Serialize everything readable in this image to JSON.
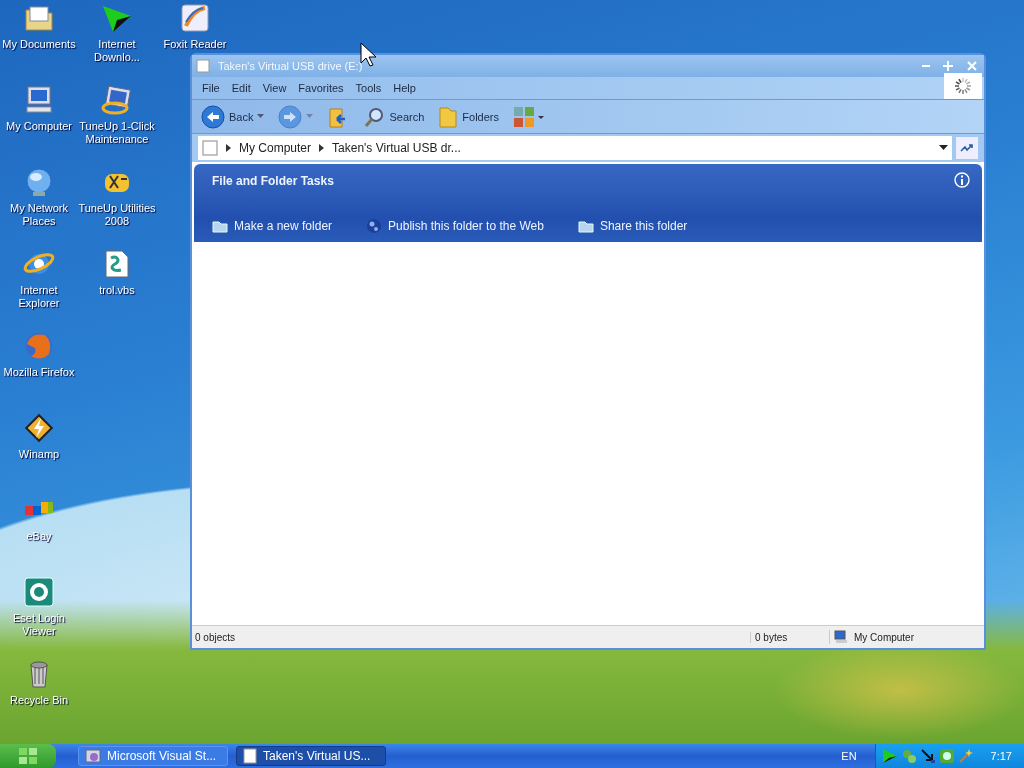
{
  "desktop": {
    "icon_columns": [
      [
        {
          "label": "My Documents",
          "kind": "documents"
        },
        {
          "label": "My Computer",
          "kind": "computer"
        },
        {
          "label": "My Network Places",
          "kind": "network"
        },
        {
          "label": "Internet Explorer",
          "kind": "ie"
        },
        {
          "label": "Mozilla Firefox",
          "kind": "firefox"
        },
        {
          "label": "Winamp",
          "kind": "winamp"
        },
        {
          "label": "eBay",
          "kind": "ebay"
        },
        {
          "label": "Eset Login Viewer",
          "kind": "eset"
        },
        {
          "label": "Recycle Bin",
          "kind": "recycle"
        }
      ],
      [
        {
          "label": "Internet Downlo...",
          "kind": "download"
        },
        {
          "label": "TuneUp 1-Click Maintenance",
          "kind": "tuneup"
        },
        {
          "label": "TuneUp Utilities 2008",
          "kind": "tools"
        },
        {
          "label": "trol.vbs",
          "kind": "script"
        }
      ],
      [
        {
          "label": "Foxit Reader",
          "kind": "pdf"
        }
      ]
    ]
  },
  "window": {
    "title": "Taken's Virtual USB drive (E:)",
    "menu": [
      "File",
      "Edit",
      "View",
      "Favorites",
      "Tools",
      "Help"
    ],
    "toolbar": [
      {
        "kind": "back",
        "label": "Back",
        "disabled": false
      },
      {
        "kind": "forward",
        "disabled": true
      },
      {
        "kind": "up",
        "disabled": false
      },
      {
        "kind": "search",
        "label": "Search",
        "disabled": false
      },
      {
        "kind": "folders",
        "label": "Folders",
        "disabled": false
      },
      {
        "kind": "views",
        "disabled": false
      }
    ],
    "address": {
      "path": [
        "My Computer",
        "Taken's Virtual USB dr..."
      ]
    },
    "task_pane": {
      "title": "File and Folder Tasks",
      "tasks": [
        {
          "label": "Make a new folder",
          "kind": "new-folder"
        },
        {
          "label": "Publish this folder to the Web",
          "kind": "publish"
        },
        {
          "label": "Share this folder",
          "kind": "share"
        }
      ]
    },
    "status_bar": {
      "objects": "0 objects",
      "size": "0 bytes",
      "zone": "My Computer"
    }
  },
  "taskbar": {
    "tasks": [
      {
        "label": "Microsoft Visual St...",
        "selected": false
      },
      {
        "label": "Taken's Virtual US...",
        "selected": true
      }
    ],
    "language": "EN",
    "clock": "7:17"
  }
}
